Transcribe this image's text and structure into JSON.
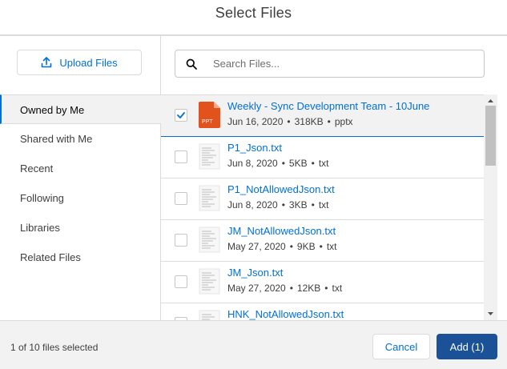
{
  "dialog": {
    "title": "Select Files"
  },
  "sidebar": {
    "upload_label": "Upload Files",
    "items": [
      {
        "label": "Owned by Me",
        "active": true
      },
      {
        "label": "Shared with Me",
        "active": false
      },
      {
        "label": "Recent",
        "active": false
      },
      {
        "label": "Following",
        "active": false
      },
      {
        "label": "Libraries",
        "active": false
      },
      {
        "label": "Related Files",
        "active": false
      }
    ]
  },
  "search": {
    "placeholder": "Search Files...",
    "value": ""
  },
  "files": [
    {
      "name": "Weekly - Sync Development Team - 10June",
      "date": "Jun 16, 2020",
      "size": "318KB",
      "ext": "pptx",
      "selected": true,
      "icon": "ppt-icon",
      "icon_label": "PPT"
    },
    {
      "name": "P1_Json.txt",
      "date": "Jun 8, 2020",
      "size": "5KB",
      "ext": "txt",
      "selected": false,
      "icon": "text-doc-icon"
    },
    {
      "name": "P1_NotAllowedJson.txt",
      "date": "Jun 8, 2020",
      "size": "3KB",
      "ext": "txt",
      "selected": false,
      "icon": "text-doc-icon"
    },
    {
      "name": "JM_NotAllowedJson.txt",
      "date": "May 27, 2020",
      "size": "9KB",
      "ext": "txt",
      "selected": false,
      "icon": "text-doc-icon"
    },
    {
      "name": "JM_Json.txt",
      "date": "May 27, 2020",
      "size": "12KB",
      "ext": "txt",
      "selected": false,
      "icon": "text-doc-icon"
    },
    {
      "name": "HNK_NotAllowedJson.txt",
      "date": "",
      "size": "",
      "ext": "",
      "selected": false,
      "icon": "text-doc-icon"
    }
  ],
  "meta_separator": "•",
  "footer": {
    "selection_count": "1 of 10 files selected",
    "cancel_label": "Cancel",
    "add_label": "Add (1)"
  },
  "colors": {
    "brand": "#0070d2",
    "primary_button": "#1b5297",
    "ppt_icon": "#e2521d",
    "border": "#dddbda"
  }
}
